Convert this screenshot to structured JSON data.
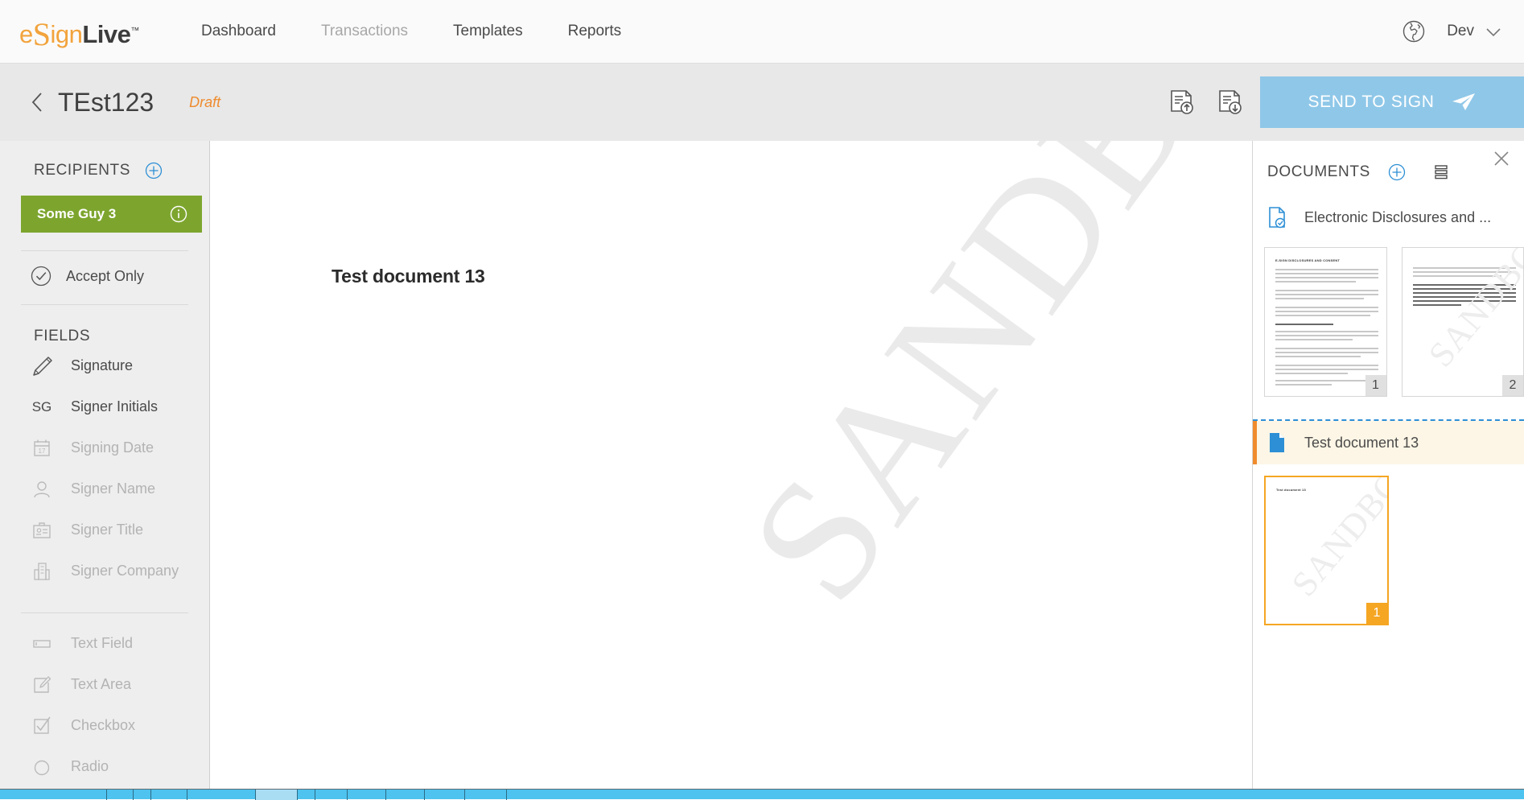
{
  "brand": {
    "logo_e": "e",
    "logo_s": "S",
    "logo_ign": "ign",
    "logo_live": "Live",
    "logo_tm": "™",
    "accent_orange": "#f2a33c",
    "accent_blue": "#8fc7e8",
    "accent_green": "#7da52e"
  },
  "topnav": {
    "links": [
      {
        "label": "Dashboard",
        "muted": false
      },
      {
        "label": "Transactions",
        "muted": true
      },
      {
        "label": "Templates",
        "muted": false
      },
      {
        "label": "Reports",
        "muted": false
      }
    ],
    "globe_icon": "globe-icon",
    "user": "Dev",
    "chevron_icon": "chevron-down-icon"
  },
  "subheader": {
    "back_icon": "chevron-left-icon",
    "title": "TEst123",
    "status": "Draft",
    "upload_icon": "document-upload-icon",
    "download_icon": "document-download-icon",
    "send_label": "SEND TO SIGN",
    "send_icon": "paper-plane-icon"
  },
  "sidebar": {
    "recipients_title": "RECIPIENTS",
    "add_recipient_icon": "plus-circle-icon",
    "recipient": {
      "name": "Some Guy 3",
      "info_icon": "info-circle-icon"
    },
    "accept_only": {
      "label": "Accept Only",
      "icon": "check-circle-icon"
    },
    "fields_title": "FIELDS",
    "fields": [
      {
        "label": "Signature",
        "icon": "pen-icon",
        "disabled": false
      },
      {
        "label": "Signer Initials",
        "icon": "initials-sg-icon",
        "disabled": false
      },
      {
        "label": "Signing Date",
        "icon": "calendar-icon",
        "disabled": true,
        "calendar_day": "17"
      },
      {
        "label": "Signer Name",
        "icon": "person-icon",
        "disabled": true
      },
      {
        "label": "Signer Title",
        "icon": "id-badge-icon",
        "disabled": true
      },
      {
        "label": "Signer Company",
        "icon": "building-icon",
        "disabled": true
      }
    ],
    "fields_group2": [
      {
        "label": "Text Field",
        "icon": "text-field-icon",
        "disabled": true
      },
      {
        "label": "Text Area",
        "icon": "text-area-icon",
        "disabled": true
      },
      {
        "label": "Checkbox",
        "icon": "checkbox-icon",
        "disabled": true
      },
      {
        "label": "Radio",
        "icon": "radio-icon",
        "disabled": true
      }
    ]
  },
  "canvas": {
    "document_heading": "Test document 13",
    "watermark": "SANDBOX"
  },
  "rightpanel": {
    "close_icon": "close-icon",
    "title": "DOCUMENTS",
    "add_document_icon": "plus-circle-icon",
    "reorder_icon": "list-lines-icon",
    "documents": [
      {
        "name": "Electronic Disclosures and ...",
        "icon": "document-check-icon",
        "selected": false,
        "pages": [
          {
            "number": "1",
            "active": false,
            "title": "E-SIGN DISCLOSURES AND CONSENT",
            "watermark": ""
          },
          {
            "number": "2",
            "active": false,
            "title": "",
            "watermark": "SANDBOX"
          }
        ]
      },
      {
        "name": "Test document 13",
        "icon": "document-icon",
        "selected": true,
        "pages": [
          {
            "number": "1",
            "active": true,
            "title": "Test document 13",
            "watermark": "SANDBOX"
          }
        ]
      }
    ]
  }
}
